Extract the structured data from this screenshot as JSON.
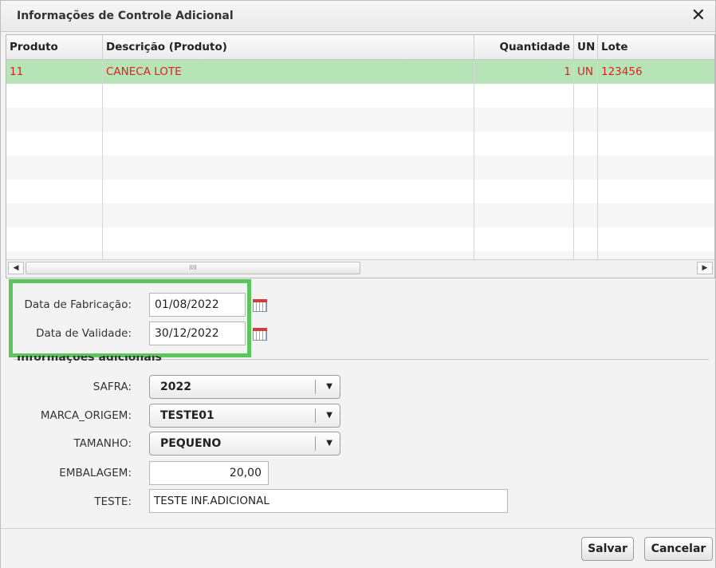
{
  "dialog": {
    "title": "Informações de Controle Adicional",
    "close_icon": "close-icon"
  },
  "grid": {
    "columns": [
      "Produto",
      "Descrição (Produto)",
      "Quantidade",
      "UN",
      "Lote"
    ],
    "rows": [
      {
        "produto": "11",
        "descricao": "CANECA LOTE",
        "quantidade": "1",
        "un": "UN",
        "lote": "123456"
      }
    ],
    "scroll_thumb_grip": "IIII",
    "selected_row_color": "#b7e4b7",
    "row_text_color": "#e02020"
  },
  "dates": {
    "fabricacao_label": "Data de Fabricação:",
    "fabricacao_value": "01/08/2022",
    "validade_label": "Data de Validade:",
    "validade_value": "30/12/2022",
    "highlight_color": "#5cc65c"
  },
  "info": {
    "section_title": "Informações adicionais",
    "safra_label": "SAFRA:",
    "safra_value": "2022",
    "marca_label": "MARCA_ORIGEM:",
    "marca_value": "TESTE01",
    "tamanho_label": "TAMANHO:",
    "tamanho_value": "PEQUENO",
    "embalagem_label": "EMBALAGEM:",
    "embalagem_value": "20,00",
    "teste_label": "TESTE:",
    "teste_value": "TESTE INF.ADICIONAL"
  },
  "footer": {
    "save_label": "Salvar",
    "cancel_label": "Cancelar"
  }
}
